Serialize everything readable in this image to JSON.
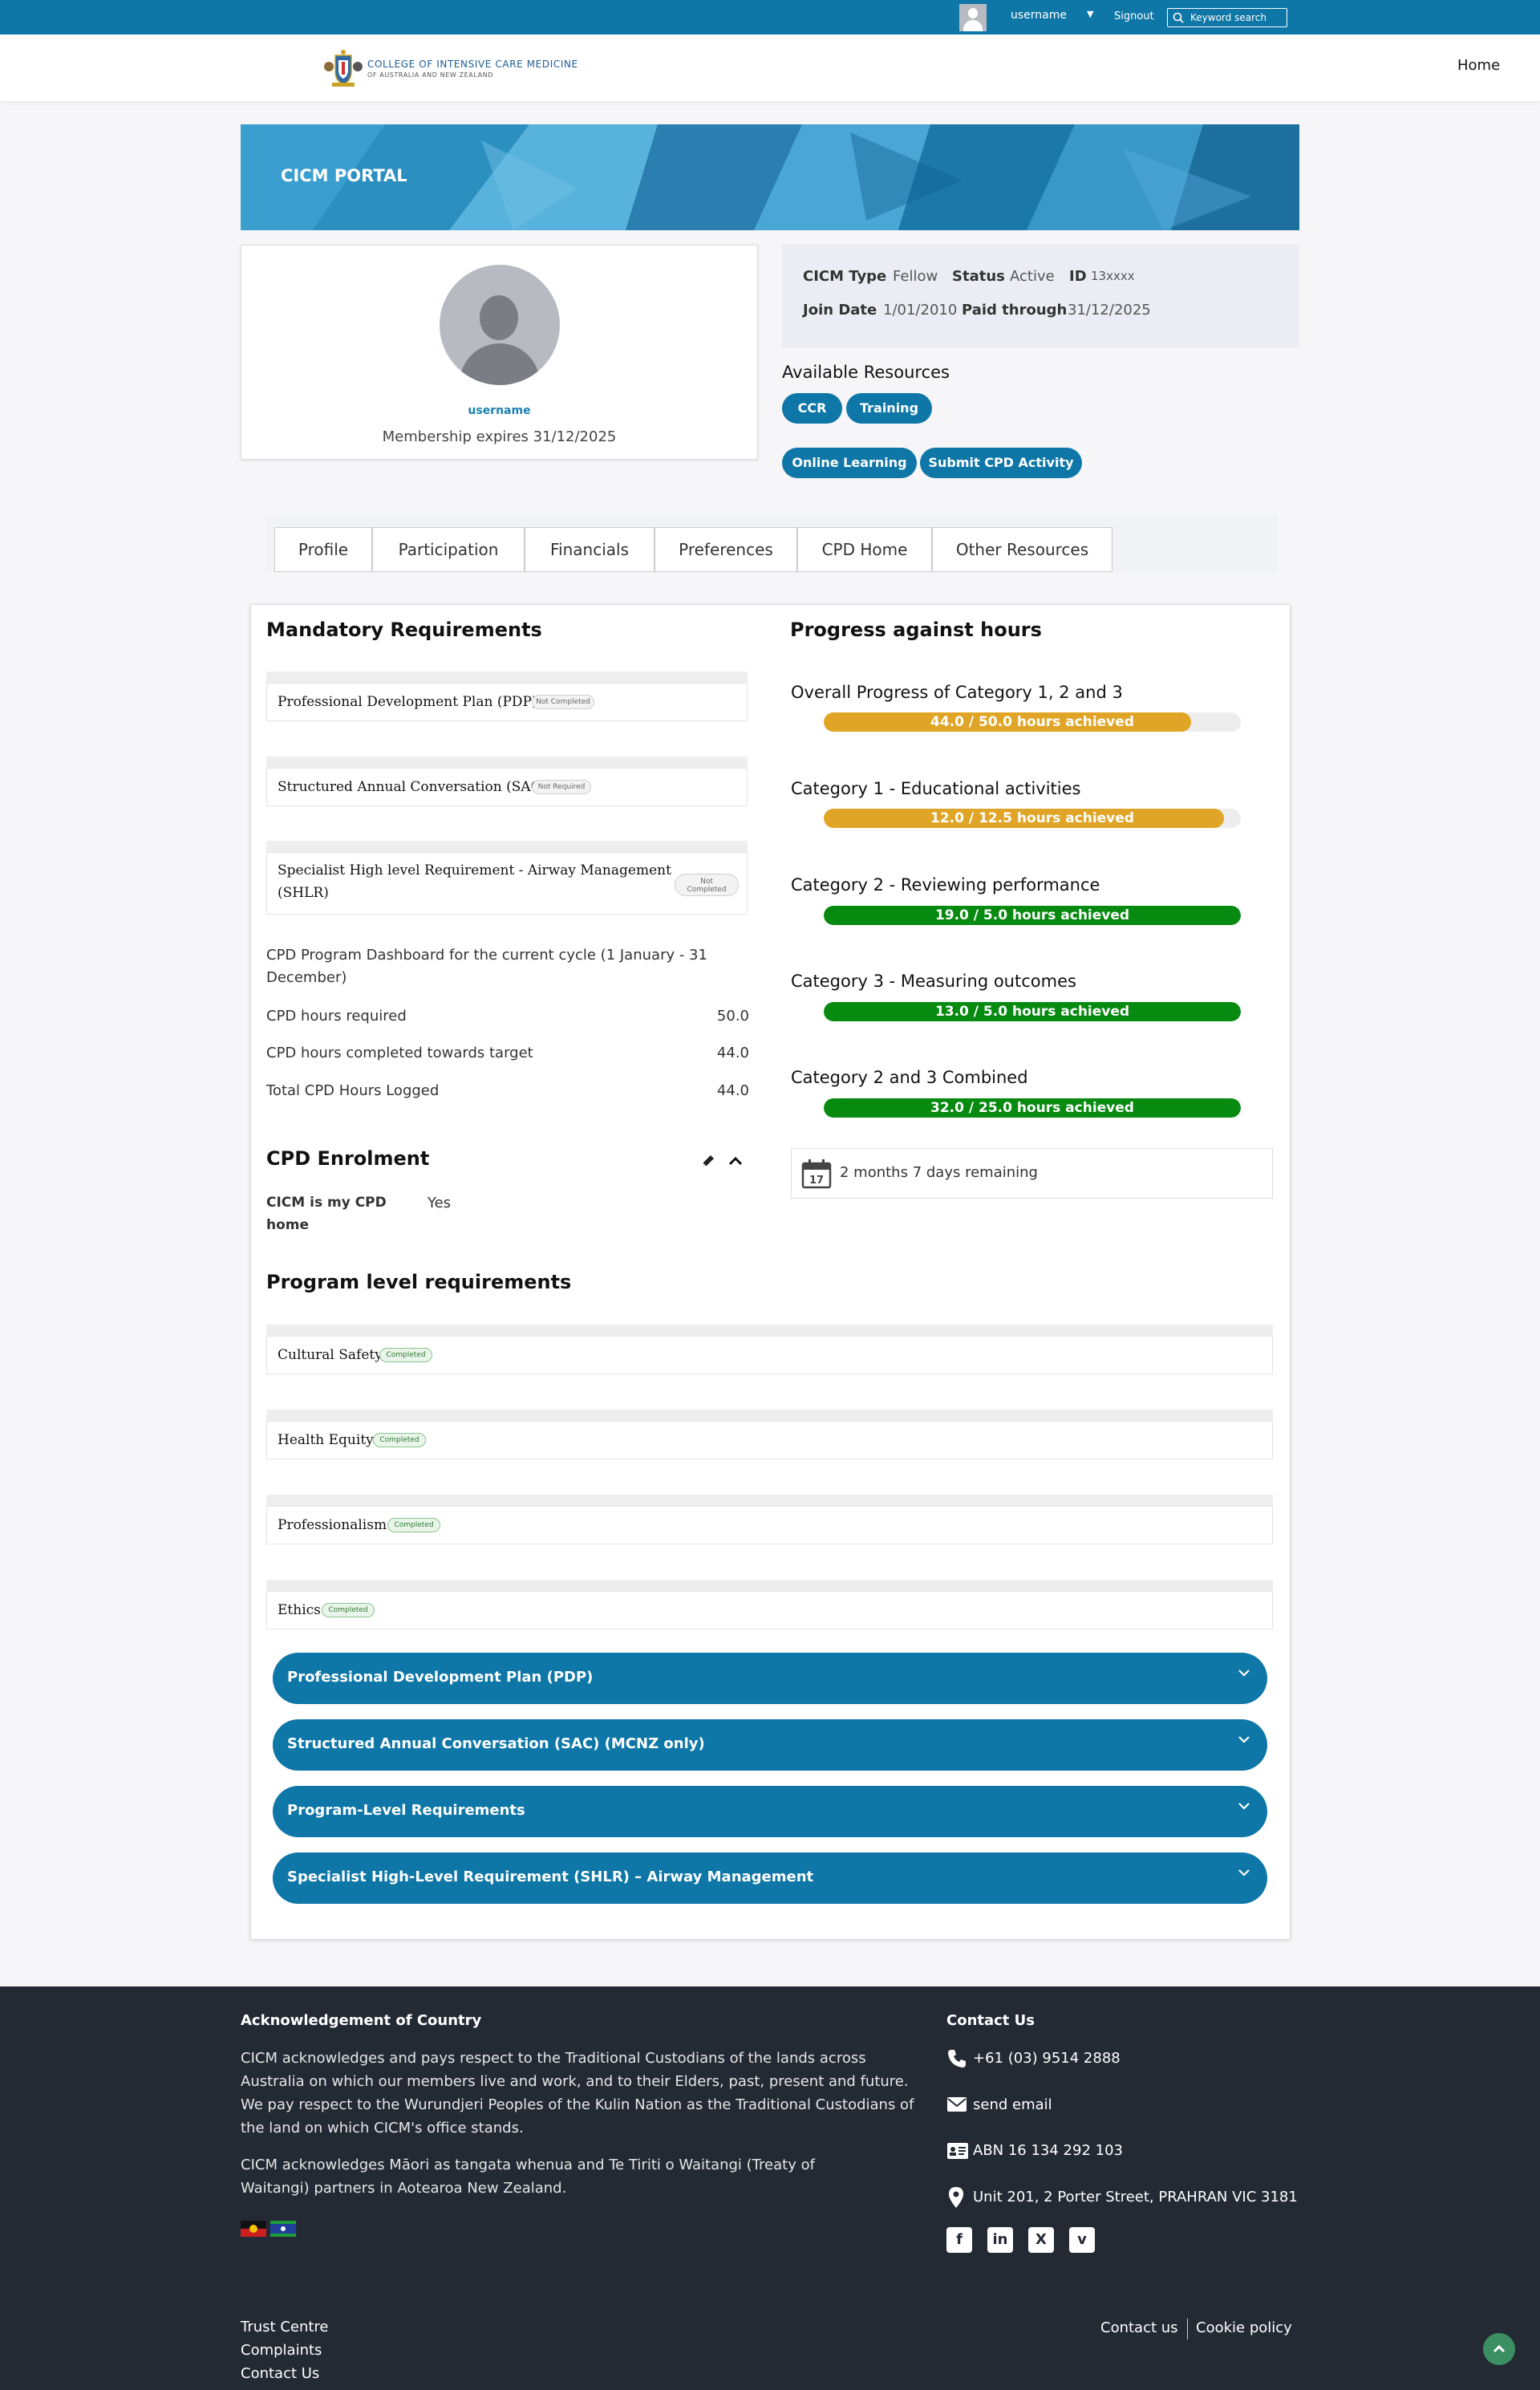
{
  "topbar": {
    "username": "username",
    "signout": "Signout",
    "search_placeholder": "Keyword search"
  },
  "header": {
    "logo_line1": "COLLEGE OF INTENSIVE CARE MEDICINE",
    "logo_line2": "OF AUSTRALIA AND NEW ZEALAND",
    "nav_home": "Home"
  },
  "banner": {
    "title": "CICM PORTAL"
  },
  "profile": {
    "username": "username",
    "membership": "Membership expires 31/12/2025"
  },
  "info": {
    "type_label": "CICM Type",
    "type_value": "Fellow",
    "status_label": "Status",
    "status_value": "Active",
    "id_label": "ID",
    "id_value": "13xxxx",
    "join_label": "Join Date",
    "join_value": "1/01/2010",
    "paid_label": "Paid through",
    "paid_value": "31/12/2025"
  },
  "resources": {
    "title": "Available Resources",
    "buttons": [
      "CCR",
      "Training",
      "Online Learning",
      "Submit CPD Activity"
    ]
  },
  "tabs": [
    "Profile",
    "Participation",
    "Financials",
    "Preferences",
    "CPD Home",
    "Other Resources"
  ],
  "mandatory": {
    "title": "Mandatory Requirements",
    "items": [
      {
        "label": "Professional Development Plan (PDP)",
        "status": "Not Completed"
      },
      {
        "label": "Structured Annual Conversation (SAC)",
        "status": "Not Required"
      },
      {
        "label_line1": "Specialist High level Requirement - Airway Management",
        "label_line2": "(SHLR)",
        "status_line1": "Not",
        "status_line2": "Completed"
      }
    ],
    "dashboard_line1": "CPD Program Dashboard for the current cycle (1 January - 31",
    "dashboard_line2": "December)",
    "hours": [
      {
        "label": "CPD hours required",
        "value": "50.0"
      },
      {
        "label": "CPD hours completed towards target",
        "value": "44.0"
      },
      {
        "label": "Total CPD Hours Logged",
        "value": "44.0"
      }
    ]
  },
  "enrolment": {
    "title": "CPD Enrolment",
    "field_label_line1": "CICM is my CPD",
    "field_label_line2": "home",
    "field_value": "Yes"
  },
  "progress": {
    "title": "Progress against hours",
    "categories": [
      {
        "title": "Overall Progress of Category 1, 2 and 3",
        "label": "44.0 / 50.0 hours achieved",
        "fraction": 0.88,
        "color": "#e0a526"
      },
      {
        "title": "Category 1 - Educational activities",
        "label": "12.0 / 12.5 hours achieved",
        "fraction": 0.96,
        "color": "#e0a526"
      },
      {
        "title": "Category 2 - Reviewing performance",
        "label": "19.0 / 5.0 hours achieved",
        "fraction": 1.0,
        "color": "#068a0f"
      },
      {
        "title": "Category 3 - Measuring outcomes",
        "label": "13.0 / 5.0 hours achieved",
        "fraction": 1.0,
        "color": "#068a0f"
      },
      {
        "title": "Category 2 and 3 Combined",
        "label": "32.0 / 25.0 hours achieved",
        "fraction": 1.0,
        "color": "#068a0f"
      }
    ],
    "calendar_day": "17",
    "remaining": "2 months 7 days remaining"
  },
  "program": {
    "title": "Program level requirements",
    "items": [
      {
        "label": "Cultural Safety",
        "status": "Completed"
      },
      {
        "label": "Health Equity",
        "status": "Completed"
      },
      {
        "label": "Professionalism",
        "status": "Completed"
      },
      {
        "label": "Ethics",
        "status": "Completed"
      }
    ]
  },
  "accordions": [
    "Professional Development Plan (PDP)",
    "Structured Annual Conversation (SAC) (MCNZ only)",
    "Program-Level Requirements",
    "Specialist High-Level Requirement (SHLR) – Airway Management"
  ],
  "footer": {
    "ack_title": "Acknowledgement of Country",
    "ack_lines": [
      "CICM acknowledges and pays respect to the Traditional Custodians of the lands across",
      "Australia on which our members live and work, and to their Elders, past, present and future.",
      "We pay respect to the Wurundjeri Peoples of the Kulin Nation as the Traditional Custodians of",
      "the land on which CICM's office stands."
    ],
    "maori_lines": [
      "CICM acknowledges Māori as tangata whenua and Te Tiriti o Waitangi (Treaty of",
      "Waitangi) partners in Aotearoa New Zealand."
    ],
    "contact_title": "Contact Us",
    "phone": "+61 (03) 9514 2888",
    "email": "send email",
    "abn": "ABN 16 134 292 103",
    "address": "Unit 201, 2 Porter Street, PRAHRAN VIC 3181",
    "social": [
      "facebook-icon",
      "linkedin-icon",
      "x-icon",
      "vimeo-icon"
    ],
    "links_left": [
      "Trust Centre",
      "Complaints",
      "Contact Us"
    ],
    "links_right": [
      "Contact us",
      "Cookie policy"
    ]
  }
}
